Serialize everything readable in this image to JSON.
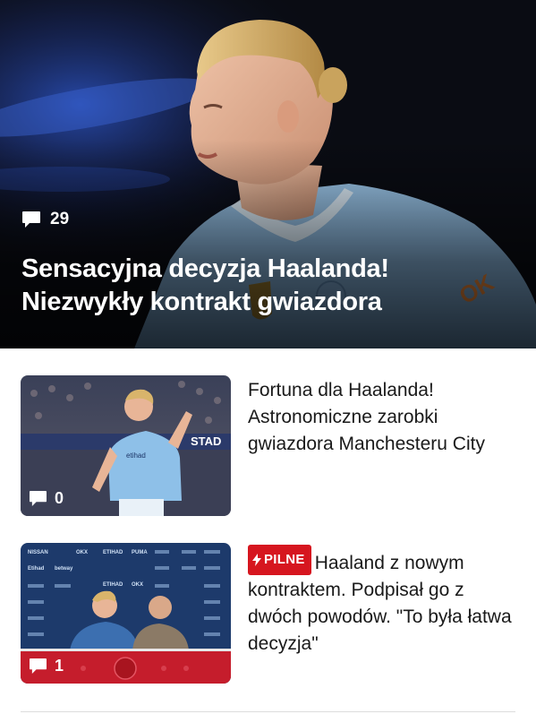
{
  "hero": {
    "comment_count": "29",
    "title_line1": "Sensacyjna decyzja Haalanda!",
    "title_line2": "Niezwykły kontrakt gwiazdora",
    "comment_icon": "speech-bubble-icon"
  },
  "articles": [
    {
      "title": "Fortuna dla Haalanda! Astronomiczne zarobki gwiazdora Manchesteru City",
      "comment_count": "0",
      "badge": null
    },
    {
      "badge": "PILNE",
      "badge_icon": "lightning-icon",
      "title": "Haaland z nowym kontraktem. Podpisał go z dwóch powodów. \"To była łatwa decyzja\"",
      "comment_count": "1"
    }
  ],
  "sponsor_wall": [
    "NISSAN",
    "OKX",
    "ETIHAD",
    "PUMA",
    "Etihad",
    "betway",
    "ETIHAD",
    "OKX"
  ],
  "colors": {
    "badge_red": "#d6161f",
    "city_blue": "#8ab8de",
    "text": "#1a1a1a"
  }
}
